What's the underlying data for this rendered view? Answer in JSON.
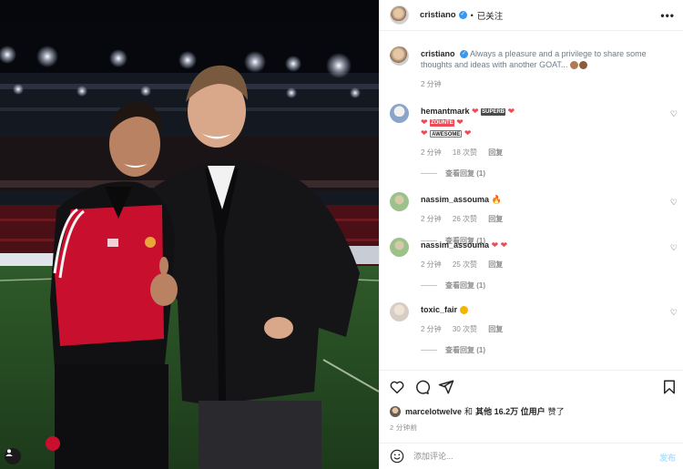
{
  "header": {
    "username": "cristiano",
    "separator": "•",
    "follow_status": "已关注",
    "more_label": "•••"
  },
  "caption": {
    "username": "cristiano",
    "text": "Always a pleasure and a privilege to share some thoughts and ideas with another GOAT...",
    "time": "2 分钟"
  },
  "comments": [
    {
      "username": "hemantmark",
      "line1": "SUPERB",
      "line2": "ZOUNTE",
      "line3": "AWESOME",
      "time": "2 分钟",
      "likes": "18 次赞",
      "reply_label": "回复",
      "view_replies": "查看回复 (1)"
    },
    {
      "username": "nassim_assouma",
      "time": "2 分钟",
      "likes": "26 次赞",
      "reply_label": "回复",
      "view_replies": "查看回复 (1)"
    },
    {
      "username": "nassim_assouma",
      "time": "2 分钟",
      "likes": "25 次赞",
      "reply_label": "回复",
      "view_replies": "查看回复 (1)"
    },
    {
      "username": "toxic_fair",
      "time": "2 分钟",
      "likes": "30 次赞",
      "reply_label": "回复",
      "view_replies": "查看回复 (1)"
    }
  ],
  "likes": {
    "liker": "marcelotwelve",
    "connector": "和",
    "others": "其他 16.2万 位用户",
    "suffix": "赞了"
  },
  "post_time": "2 分钟前",
  "comment_box": {
    "placeholder": "添加评论...",
    "post_label": "发布"
  },
  "colors": {
    "verified": "#3897f0",
    "heart": "#ed4956",
    "post_button": "#b2dffc",
    "secondary_text": "#8e8e8e"
  },
  "icons": [
    "heart-icon",
    "comment-icon",
    "share-icon",
    "bookmark-icon",
    "emoji-icon",
    "user-tag-icon",
    "more-icon",
    "verified-icon"
  ]
}
